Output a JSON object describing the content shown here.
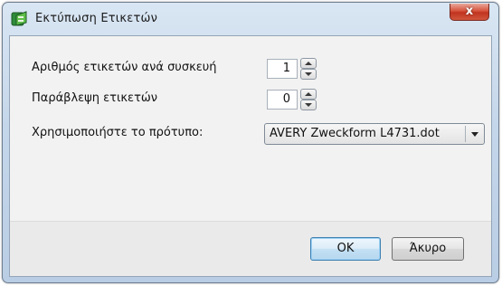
{
  "window": {
    "title": "Εκτύπωση Ετικετών",
    "close_label": "x"
  },
  "form": {
    "labels_per_device": {
      "label": "Αριθμός ετικετών ανά συσκευή",
      "value": "1"
    },
    "skip_labels": {
      "label": "Παράβλεψη ετικετών",
      "value": "0"
    },
    "template": {
      "label": "Χρησιμοποιήστε το πρότυπο:",
      "selected": "AVERY Zweckform L4731.dot"
    }
  },
  "buttons": {
    "ok": "OK",
    "cancel": "Άκυρο"
  },
  "colors": {
    "titlebar": "#c4d6ea",
    "close_button": "#c0341f",
    "client_bg": "#f2f2f2",
    "default_button_border": "#3c7fb1"
  }
}
